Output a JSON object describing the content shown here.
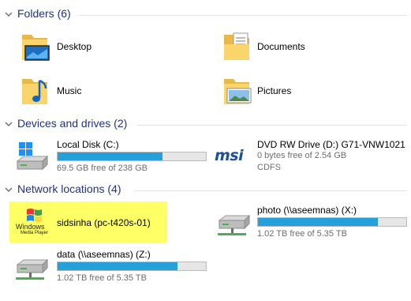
{
  "groups": {
    "folders": {
      "title": "Folders (6)"
    },
    "devices": {
      "title": "Devices and drives (2)"
    },
    "network": {
      "title": "Network locations (4)"
    }
  },
  "folders": [
    {
      "label": "Desktop",
      "icon": "desktop-folder-icon"
    },
    {
      "label": "Documents",
      "icon": "documents-folder-icon"
    },
    {
      "label": "Music",
      "icon": "music-folder-icon"
    },
    {
      "label": "Pictures",
      "icon": "pictures-folder-icon"
    }
  ],
  "drives": [
    {
      "label": "Local Disk (C:)",
      "sub": "69.5 GB free of 238 GB",
      "used_fraction": 0.71,
      "icon": "windows-drive-icon"
    },
    {
      "label": "DVD RW Drive (D:) G71-VNW1021",
      "sub": "0 bytes free of 2.54 GB",
      "sub2": "CDFS",
      "icon": "msi-dvd-icon",
      "logo_text": "msi"
    }
  ],
  "network": [
    {
      "label": "sidsinha (pc-t420s-01)",
      "icon": "windows-media-player-icon",
      "logo_text_1": "Windows",
      "logo_text_2": "Media Player",
      "selected": true
    },
    {
      "label": "photo (\\\\aseemnas) (X:)",
      "sub": "1.02 TB free of 5.35 TB",
      "used_fraction": 0.81,
      "icon": "network-drive-icon"
    },
    {
      "label": "data (\\\\aseemnas) (Z:)",
      "sub": "1.02 TB free of 5.35 TB",
      "used_fraction": 0.81,
      "icon": "network-drive-icon"
    }
  ],
  "colors": {
    "accent": "#26a0da",
    "header": "#1e3287",
    "selection": "#ffff66"
  }
}
